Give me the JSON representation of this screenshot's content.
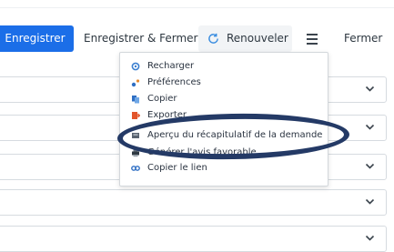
{
  "toolbar": {
    "save_label": "Enregistrer",
    "save_close_label": "Enregistrer & Fermer",
    "renew_label": "Renouveler",
    "close_label": "Fermer",
    "accent_color": "#1b6ee8"
  },
  "menu": {
    "items": [
      {
        "label": "Recharger",
        "icon": "refresh-icon"
      },
      {
        "label": "Préférences",
        "icon": "preferences-icon"
      },
      {
        "label": "Copier",
        "icon": "copy-icon"
      },
      {
        "label": "Exporter",
        "icon": "export-icon"
      },
      {
        "label": "Aperçu du récapitulatif de la demande",
        "icon": "preview-icon"
      },
      {
        "label": "Générer l'avis favorable",
        "icon": "print-icon"
      },
      {
        "label": "Copier le lien",
        "icon": "link-icon"
      }
    ]
  },
  "annotation": {
    "color": "#243a66"
  }
}
